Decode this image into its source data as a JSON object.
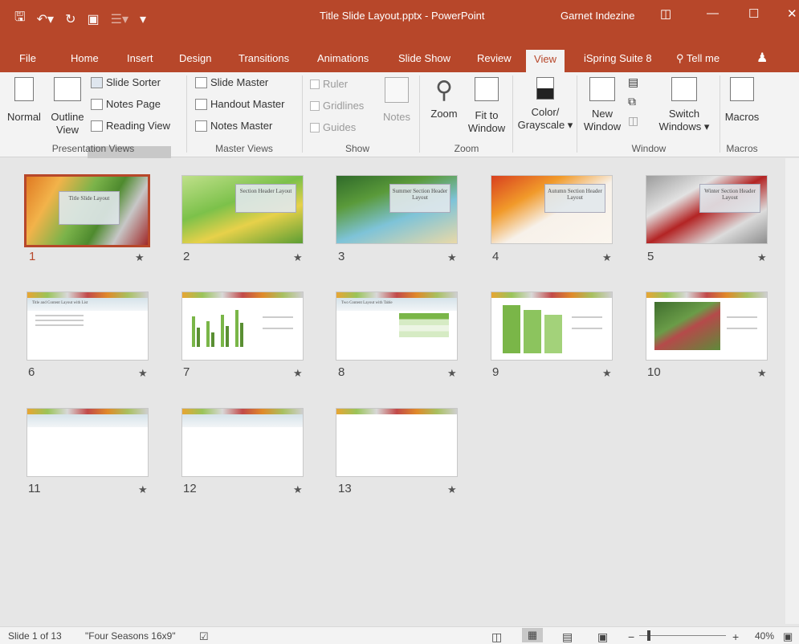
{
  "title_bar": {
    "doc_title": "Title Slide Layout.pptx  -  PowerPoint",
    "user_name": "Garnet Indezine"
  },
  "tabs": [
    "File",
    "Home",
    "Insert",
    "Design",
    "Transitions",
    "Animations",
    "Slide Show",
    "Review",
    "View",
    "iSpring Suite 8",
    "Tell me"
  ],
  "active_tab": "View",
  "ribbon": {
    "presentation_views": {
      "group_label": "Presentation Views",
      "normal": "Normal",
      "outline_line1": "Outline",
      "outline_line2": "View",
      "slide_sorter": "Slide Sorter",
      "notes_page": "Notes Page",
      "reading_view": "Reading View"
    },
    "master_views": {
      "group_label": "Master Views",
      "slide_master": "Slide Master",
      "handout_master": "Handout Master",
      "notes_master": "Notes Master"
    },
    "show": {
      "group_label": "Show",
      "ruler": "Ruler",
      "gridlines": "Gridlines",
      "guides": "Guides",
      "notes": "Notes"
    },
    "zoom": {
      "group_label": "Zoom",
      "zoom": "Zoom",
      "fit_line1": "Fit to",
      "fit_line2": "Window"
    },
    "color": {
      "line1": "Color/",
      "line2": "Grayscale"
    },
    "window": {
      "group_label": "Window",
      "new_line1": "New",
      "new_line2": "Window",
      "switch_line1": "Switch",
      "switch_line2": "Windows"
    },
    "macros": {
      "group_label": "Macros",
      "macros": "Macros"
    }
  },
  "slides": [
    {
      "number": "1",
      "title": "Title Slide Layout",
      "theme": "autumn-spring"
    },
    {
      "number": "2",
      "title": "Section Header Layout",
      "theme": "spring"
    },
    {
      "number": "3",
      "title": "Summer Section Header Layout",
      "theme": "summer"
    },
    {
      "number": "4",
      "title": "Autumn Section Header Layout",
      "theme": "autumn"
    },
    {
      "number": "5",
      "title": "Winter Section Header Layout",
      "theme": "winter"
    },
    {
      "number": "6",
      "title": "Title and Content Layout with List",
      "theme": "content"
    },
    {
      "number": "7",
      "title": "",
      "theme": "chart"
    },
    {
      "number": "8",
      "title": "Two Content Layout with Table",
      "theme": "table"
    },
    {
      "number": "9",
      "title": "",
      "theme": "smartart"
    },
    {
      "number": "10",
      "title": "",
      "theme": "picture"
    },
    {
      "number": "11",
      "title": "",
      "theme": "blank"
    },
    {
      "number": "12",
      "title": "",
      "theme": "blank"
    },
    {
      "number": "13",
      "title": "",
      "theme": "blank-plain"
    }
  ],
  "status_bar": {
    "slide_of": "Slide 1 of 13",
    "theme_name": "\"Four Seasons 16x9\"",
    "zoom_minus": "−",
    "zoom_plus": "+",
    "zoom_level": "40%"
  },
  "colors": {
    "accent": "#b7472a",
    "ribbon_bg": "#f3f3f3",
    "workspace_bg": "#e6e6e6"
  }
}
